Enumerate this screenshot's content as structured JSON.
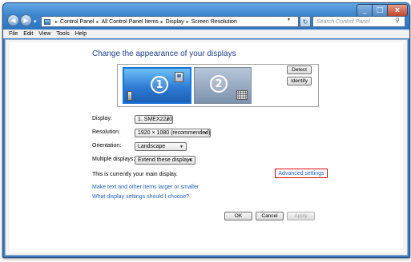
{
  "titlebar": {
    "minimize": "_",
    "maximize": "□",
    "close": "x"
  },
  "nav": {
    "back": "◀",
    "forward": "▶",
    "history": "▾"
  },
  "address": {
    "crumbs": [
      "Control Panel",
      "All Control Panel Items",
      "Display",
      "Screen Resolution"
    ],
    "separator": "▸",
    "dropdown": "▾",
    "refresh": "↻"
  },
  "search": {
    "placeholder": "Search Control Panel",
    "icon": "search-icon"
  },
  "menu": {
    "items": [
      "File",
      "Edit",
      "View",
      "Tools",
      "Help"
    ]
  },
  "main": {
    "heading": "Change the appearance of your displays",
    "monitors": [
      {
        "number": "1",
        "selected": true
      },
      {
        "number": "2",
        "selected": false
      }
    ],
    "detect_label": "Detect",
    "identify_label": "Identify",
    "settings": [
      {
        "label": "Display:",
        "value": "1. SMEX2220"
      },
      {
        "label": "Resolution:",
        "value": "1920 × 1080 (recommended)"
      },
      {
        "label": "Orientation:",
        "value": "Landscape"
      },
      {
        "label": "Multiple displays:",
        "value": "Extend these displays"
      }
    ],
    "main_display_text": "This is currently your main display.",
    "advanced_link": "Advanced settings",
    "links": [
      "Make text and other items larger or smaller",
      "What display settings should I choose?"
    ],
    "ok_label": "OK",
    "cancel_label": "Cancel",
    "apply_label": "Apply"
  },
  "colors": {
    "accent": "#1a73d8",
    "heading": "#1e3f8a",
    "link": "#2161b8",
    "highlight_box": "#d10e0e"
  }
}
